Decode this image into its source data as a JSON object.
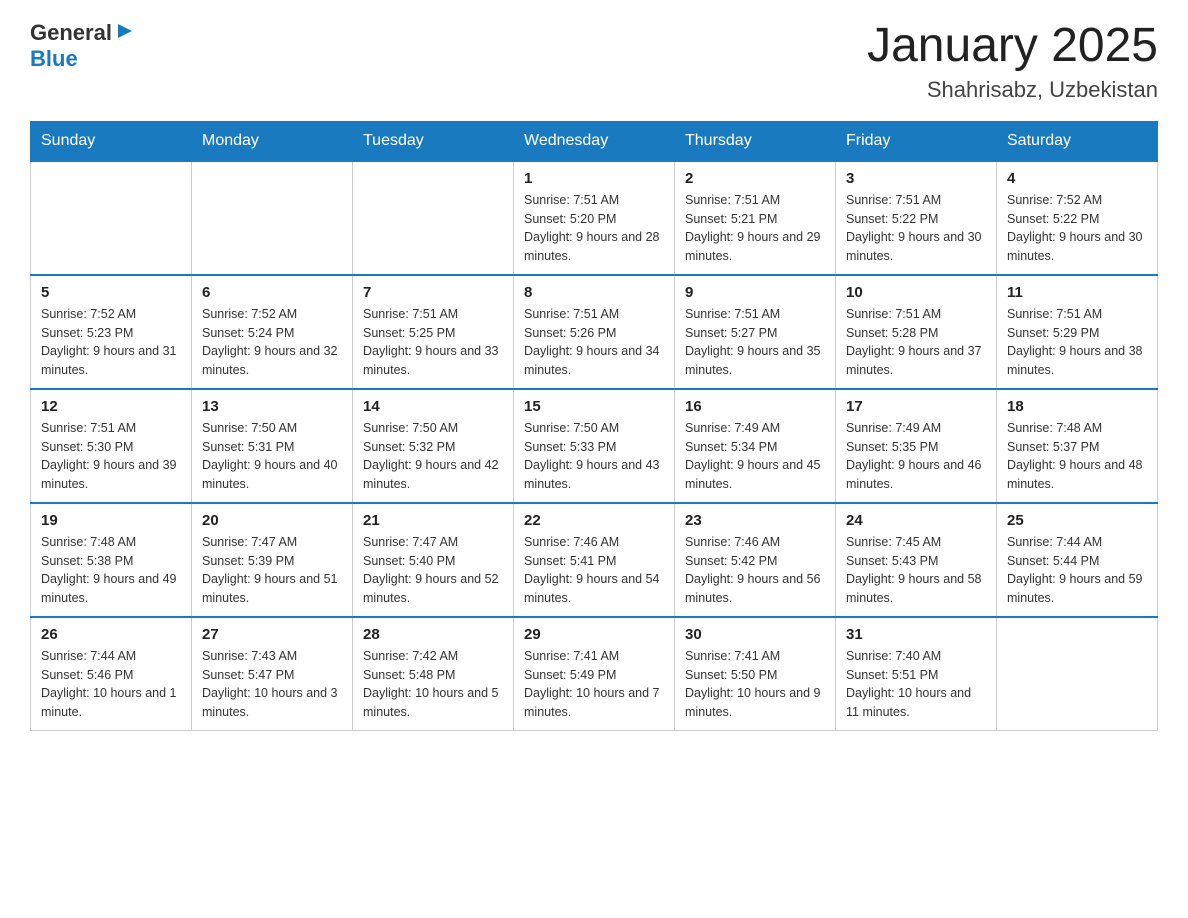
{
  "header": {
    "logo": {
      "general": "General",
      "arrow_symbol": "▶",
      "blue": "Blue"
    },
    "month": "January 2025",
    "location": "Shahrisabz, Uzbekistan"
  },
  "weekdays": [
    "Sunday",
    "Monday",
    "Tuesday",
    "Wednesday",
    "Thursday",
    "Friday",
    "Saturday"
  ],
  "weeks": [
    [
      {
        "day": "",
        "info": ""
      },
      {
        "day": "",
        "info": ""
      },
      {
        "day": "",
        "info": ""
      },
      {
        "day": "1",
        "info": "Sunrise: 7:51 AM\nSunset: 5:20 PM\nDaylight: 9 hours\nand 28 minutes."
      },
      {
        "day": "2",
        "info": "Sunrise: 7:51 AM\nSunset: 5:21 PM\nDaylight: 9 hours\nand 29 minutes."
      },
      {
        "day": "3",
        "info": "Sunrise: 7:51 AM\nSunset: 5:22 PM\nDaylight: 9 hours\nand 30 minutes."
      },
      {
        "day": "4",
        "info": "Sunrise: 7:52 AM\nSunset: 5:22 PM\nDaylight: 9 hours\nand 30 minutes."
      }
    ],
    [
      {
        "day": "5",
        "info": "Sunrise: 7:52 AM\nSunset: 5:23 PM\nDaylight: 9 hours\nand 31 minutes."
      },
      {
        "day": "6",
        "info": "Sunrise: 7:52 AM\nSunset: 5:24 PM\nDaylight: 9 hours\nand 32 minutes."
      },
      {
        "day": "7",
        "info": "Sunrise: 7:51 AM\nSunset: 5:25 PM\nDaylight: 9 hours\nand 33 minutes."
      },
      {
        "day": "8",
        "info": "Sunrise: 7:51 AM\nSunset: 5:26 PM\nDaylight: 9 hours\nand 34 minutes."
      },
      {
        "day": "9",
        "info": "Sunrise: 7:51 AM\nSunset: 5:27 PM\nDaylight: 9 hours\nand 35 minutes."
      },
      {
        "day": "10",
        "info": "Sunrise: 7:51 AM\nSunset: 5:28 PM\nDaylight: 9 hours\nand 37 minutes."
      },
      {
        "day": "11",
        "info": "Sunrise: 7:51 AM\nSunset: 5:29 PM\nDaylight: 9 hours\nand 38 minutes."
      }
    ],
    [
      {
        "day": "12",
        "info": "Sunrise: 7:51 AM\nSunset: 5:30 PM\nDaylight: 9 hours\nand 39 minutes."
      },
      {
        "day": "13",
        "info": "Sunrise: 7:50 AM\nSunset: 5:31 PM\nDaylight: 9 hours\nand 40 minutes."
      },
      {
        "day": "14",
        "info": "Sunrise: 7:50 AM\nSunset: 5:32 PM\nDaylight: 9 hours\nand 42 minutes."
      },
      {
        "day": "15",
        "info": "Sunrise: 7:50 AM\nSunset: 5:33 PM\nDaylight: 9 hours\nand 43 minutes."
      },
      {
        "day": "16",
        "info": "Sunrise: 7:49 AM\nSunset: 5:34 PM\nDaylight: 9 hours\nand 45 minutes."
      },
      {
        "day": "17",
        "info": "Sunrise: 7:49 AM\nSunset: 5:35 PM\nDaylight: 9 hours\nand 46 minutes."
      },
      {
        "day": "18",
        "info": "Sunrise: 7:48 AM\nSunset: 5:37 PM\nDaylight: 9 hours\nand 48 minutes."
      }
    ],
    [
      {
        "day": "19",
        "info": "Sunrise: 7:48 AM\nSunset: 5:38 PM\nDaylight: 9 hours\nand 49 minutes."
      },
      {
        "day": "20",
        "info": "Sunrise: 7:47 AM\nSunset: 5:39 PM\nDaylight: 9 hours\nand 51 minutes."
      },
      {
        "day": "21",
        "info": "Sunrise: 7:47 AM\nSunset: 5:40 PM\nDaylight: 9 hours\nand 52 minutes."
      },
      {
        "day": "22",
        "info": "Sunrise: 7:46 AM\nSunset: 5:41 PM\nDaylight: 9 hours\nand 54 minutes."
      },
      {
        "day": "23",
        "info": "Sunrise: 7:46 AM\nSunset: 5:42 PM\nDaylight: 9 hours\nand 56 minutes."
      },
      {
        "day": "24",
        "info": "Sunrise: 7:45 AM\nSunset: 5:43 PM\nDaylight: 9 hours\nand 58 minutes."
      },
      {
        "day": "25",
        "info": "Sunrise: 7:44 AM\nSunset: 5:44 PM\nDaylight: 9 hours\nand 59 minutes."
      }
    ],
    [
      {
        "day": "26",
        "info": "Sunrise: 7:44 AM\nSunset: 5:46 PM\nDaylight: 10 hours\nand 1 minute."
      },
      {
        "day": "27",
        "info": "Sunrise: 7:43 AM\nSunset: 5:47 PM\nDaylight: 10 hours\nand 3 minutes."
      },
      {
        "day": "28",
        "info": "Sunrise: 7:42 AM\nSunset: 5:48 PM\nDaylight: 10 hours\nand 5 minutes."
      },
      {
        "day": "29",
        "info": "Sunrise: 7:41 AM\nSunset: 5:49 PM\nDaylight: 10 hours\nand 7 minutes."
      },
      {
        "day": "30",
        "info": "Sunrise: 7:41 AM\nSunset: 5:50 PM\nDaylight: 10 hours\nand 9 minutes."
      },
      {
        "day": "31",
        "info": "Sunrise: 7:40 AM\nSunset: 5:51 PM\nDaylight: 10 hours\nand 11 minutes."
      },
      {
        "day": "",
        "info": ""
      }
    ]
  ]
}
